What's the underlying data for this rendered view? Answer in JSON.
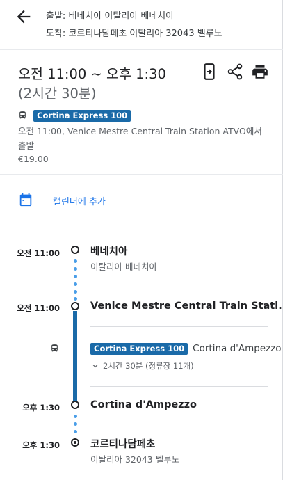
{
  "header": {
    "origin_label": "출발",
    "origin_value": "베네치아 이탈리아 베네치아",
    "destination_label": "도착",
    "destination_value": "코르티나담페초 이탈리아 32043 벨루노"
  },
  "summary": {
    "time_range": "오전 11:00 ~ 오후 1:30",
    "duration": "(2시간 30분)",
    "route_name": "Cortina Express 100",
    "depart_text": "오전 11:00, Venice Mestre Central Train Station ATVO에서 출발",
    "price": "€19.00"
  },
  "actions": {
    "calendar_label": "캘린더에 추가"
  },
  "timeline": {
    "start": {
      "time": "오전 11:00",
      "place": "베네치아",
      "sub": "이탈리아 베네치아"
    },
    "board": {
      "time": "오전 11:00",
      "place": "Venice Mestre Central Train Stati..."
    },
    "transit": {
      "route_name": "Cortina Express 100",
      "headsign": "Cortina d'Ampezzo",
      "stops_text": "2시간 30분 (정류장 11개)"
    },
    "alight": {
      "time": "오후 1:30",
      "place": "Cortina d'Ampezzo"
    },
    "end": {
      "time": "오후 1:30",
      "place": "코르티나담페초",
      "sub": "이탈리아 32043 벨루노"
    }
  },
  "colors": {
    "accent": "#1a73e8",
    "route_badge": "#1a6aa8",
    "walk_dots": "#4a9ee8"
  }
}
